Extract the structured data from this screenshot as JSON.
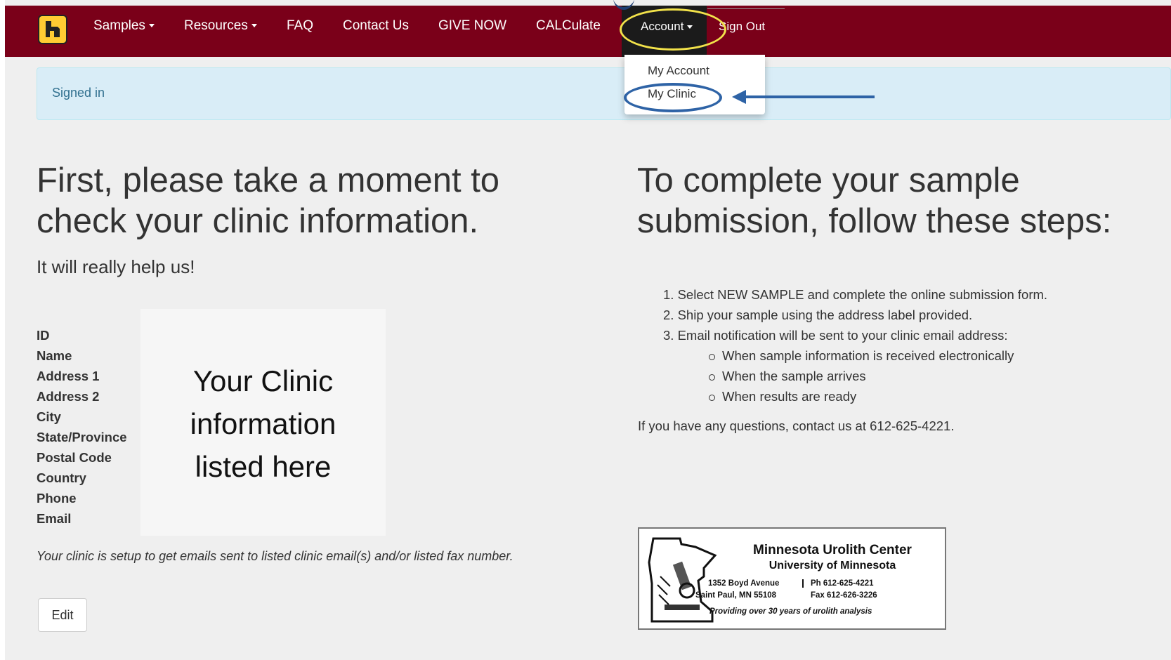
{
  "nav": {
    "items": [
      {
        "label": "Samples",
        "dropdown": true
      },
      {
        "label": "Resources",
        "dropdown": true
      },
      {
        "label": "FAQ"
      },
      {
        "label": "Contact Us"
      },
      {
        "label": "GIVE NOW"
      },
      {
        "label": "CALCulate"
      },
      {
        "label": "Account",
        "dropdown": true,
        "active": true
      },
      {
        "label": "Sign Out"
      }
    ],
    "account_menu": [
      "My Account",
      "My Clinic"
    ]
  },
  "alert": {
    "text": "Signed in"
  },
  "left": {
    "heading_line1": "First, please take a moment to",
    "heading_line2": "check your clinic information.",
    "subtitle": "It will really help us!",
    "fields": [
      "ID",
      "Name",
      "Address 1",
      "Address 2",
      "City",
      "State/Province",
      "Postal Code",
      "Country",
      "Phone",
      "Email"
    ],
    "placeholder_line1": "Your Clinic",
    "placeholder_line2": "information",
    "placeholder_line3": "listed here",
    "note": "Your clinic is setup to get emails sent to listed clinic email(s) and/or listed fax number.",
    "edit_label": "Edit"
  },
  "right": {
    "heading_line1": "To complete your sample",
    "heading_line2": "submission, follow these steps:",
    "steps": [
      "Select NEW SAMPLE and complete the online submission form.",
      "Ship your sample using the address label provided.",
      "Email notification will be sent to your clinic email address:"
    ],
    "sub_steps": [
      "When sample information is received electronically",
      "When the sample arrives",
      "When results are ready"
    ],
    "contact": "If you have any questions, contact us at 612-625-4221."
  },
  "card": {
    "title": "Minnesota Urolith Center",
    "subtitle": "University of Minnesota",
    "address1": "1352 Boyd Avenue",
    "address2": "Saint Paul, MN  55108",
    "phone": "Ph 612-625-4221",
    "fax": "Fax 612-626-3226",
    "tagline": "Providing over 30 years of urolith analysis"
  },
  "colors": {
    "brand": "#7a0019",
    "gold": "#ffcc33",
    "highlight_yellow": "#f2e24a",
    "annotation_blue": "#2e63a6"
  }
}
